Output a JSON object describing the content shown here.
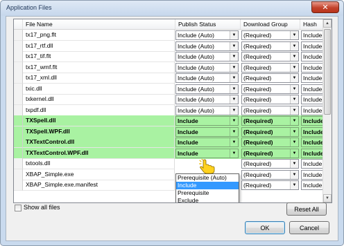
{
  "window": {
    "title": "Application Files",
    "close_symbol": "✕"
  },
  "grid": {
    "columns": [
      "File Name",
      "Publish Status",
      "Download Group",
      "Hash"
    ],
    "rows": [
      {
        "name": "tx17_png.flt",
        "publish": "Include (Auto)",
        "group": "(Required)",
        "hash": "Include",
        "highlight": false
      },
      {
        "name": "tx17_rtf.dll",
        "publish": "Include (Auto)",
        "group": "(Required)",
        "hash": "Include",
        "highlight": false
      },
      {
        "name": "tx17_tif.flt",
        "publish": "Include (Auto)",
        "group": "(Required)",
        "hash": "Include",
        "highlight": false
      },
      {
        "name": "tx17_wmf.flt",
        "publish": "Include (Auto)",
        "group": "(Required)",
        "hash": "Include",
        "highlight": false
      },
      {
        "name": "tx17_xml.dll",
        "publish": "Include (Auto)",
        "group": "(Required)",
        "hash": "Include",
        "highlight": false
      },
      {
        "name": "txic.dll",
        "publish": "Include (Auto)",
        "group": "(Required)",
        "hash": "Include",
        "highlight": false
      },
      {
        "name": "txkernel.dll",
        "publish": "Include (Auto)",
        "group": "(Required)",
        "hash": "Include",
        "highlight": false
      },
      {
        "name": "txpdf.dll",
        "publish": "Include (Auto)",
        "group": "(Required)",
        "hash": "Include",
        "highlight": false
      },
      {
        "name": "TXSpell.dll",
        "publish": "Include",
        "group": "(Required)",
        "hash": "Include",
        "highlight": true
      },
      {
        "name": "TXSpell.WPF.dll",
        "publish": "Include",
        "group": "(Required)",
        "hash": "Include",
        "highlight": true
      },
      {
        "name": "TXTextControl.dll",
        "publish": "Include",
        "group": "(Required)",
        "hash": "Include",
        "highlight": true
      },
      {
        "name": "TXTextControl.WPF.dll",
        "publish": "Include",
        "group": "(Required)",
        "hash": "Include",
        "highlight": true
      },
      {
        "name": "txtools.dll",
        "publish": "",
        "group": "(Required)",
        "hash": "Include",
        "highlight": false
      },
      {
        "name": "XBAP_Simple.exe",
        "publish": "",
        "group": "(Required)",
        "hash": "Include",
        "highlight": false
      },
      {
        "name": "XBAP_Simple.exe.manifest",
        "publish": "",
        "group": "(Required)",
        "hash": "Include",
        "highlight": false
      }
    ]
  },
  "publish_dropdown": {
    "options": [
      "Prerequisite (Auto)",
      "Include",
      "Prerequisite",
      "Exclude"
    ],
    "selected_index": 1
  },
  "footer": {
    "show_all_label": "Show all files",
    "show_all_checked": false,
    "reset_label": "Reset All",
    "ok_label": "OK",
    "cancel_label": "Cancel"
  },
  "icons": {
    "combo_arrow": "▼",
    "scroll_up": "▲",
    "scroll_down": "▼",
    "close": "close-icon",
    "cursor": "hand-pointer-icon"
  },
  "colors": {
    "highlight": "#a9f2a2",
    "selection": "#3399ff"
  }
}
